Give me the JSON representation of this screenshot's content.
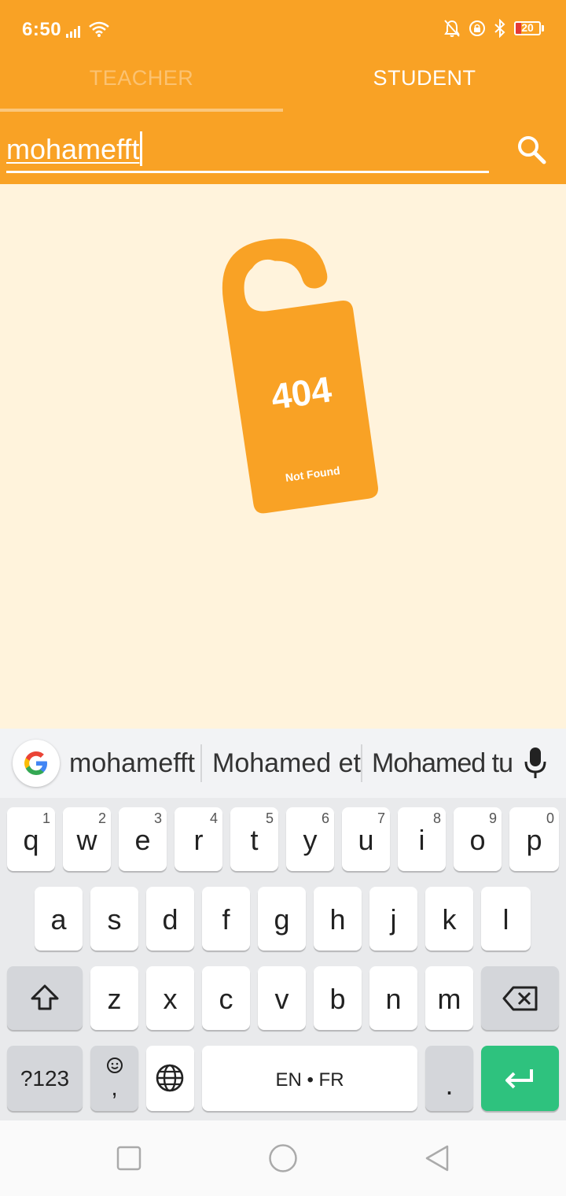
{
  "status_bar": {
    "time": "6:50",
    "battery": "20",
    "icons": [
      "signal-icon",
      "wifi-icon",
      "bell-off-icon",
      "rotation-lock-icon",
      "bluetooth-icon",
      "battery-icon"
    ]
  },
  "tabs": [
    {
      "label": "TEACHER",
      "active": false
    },
    {
      "label": "STUDENT",
      "active": true
    }
  ],
  "search": {
    "value": "mohamefft"
  },
  "empty_state": {
    "code": "404",
    "message": "Not Found"
  },
  "keyboard": {
    "suggestions": [
      "mohamefft",
      "Mohamed et",
      "Mohamed tu"
    ],
    "row1": [
      {
        "k": "q",
        "h": "1"
      },
      {
        "k": "w",
        "h": "2"
      },
      {
        "k": "e",
        "h": "3"
      },
      {
        "k": "r",
        "h": "4"
      },
      {
        "k": "t",
        "h": "5"
      },
      {
        "k": "y",
        "h": "6"
      },
      {
        "k": "u",
        "h": "7"
      },
      {
        "k": "i",
        "h": "8"
      },
      {
        "k": "o",
        "h": "9"
      },
      {
        "k": "p",
        "h": "0"
      }
    ],
    "row2": [
      "a",
      "s",
      "d",
      "f",
      "g",
      "h",
      "j",
      "k",
      "l"
    ],
    "row3": [
      "z",
      "x",
      "c",
      "v",
      "b",
      "n",
      "m"
    ],
    "symbols_label": "?123",
    "comma_label": ",",
    "space_label": "EN • FR",
    "period_label": ".",
    "colors": {
      "enter": "#2ec27e",
      "header": "#f9a225",
      "background": "#fff3dc"
    }
  }
}
